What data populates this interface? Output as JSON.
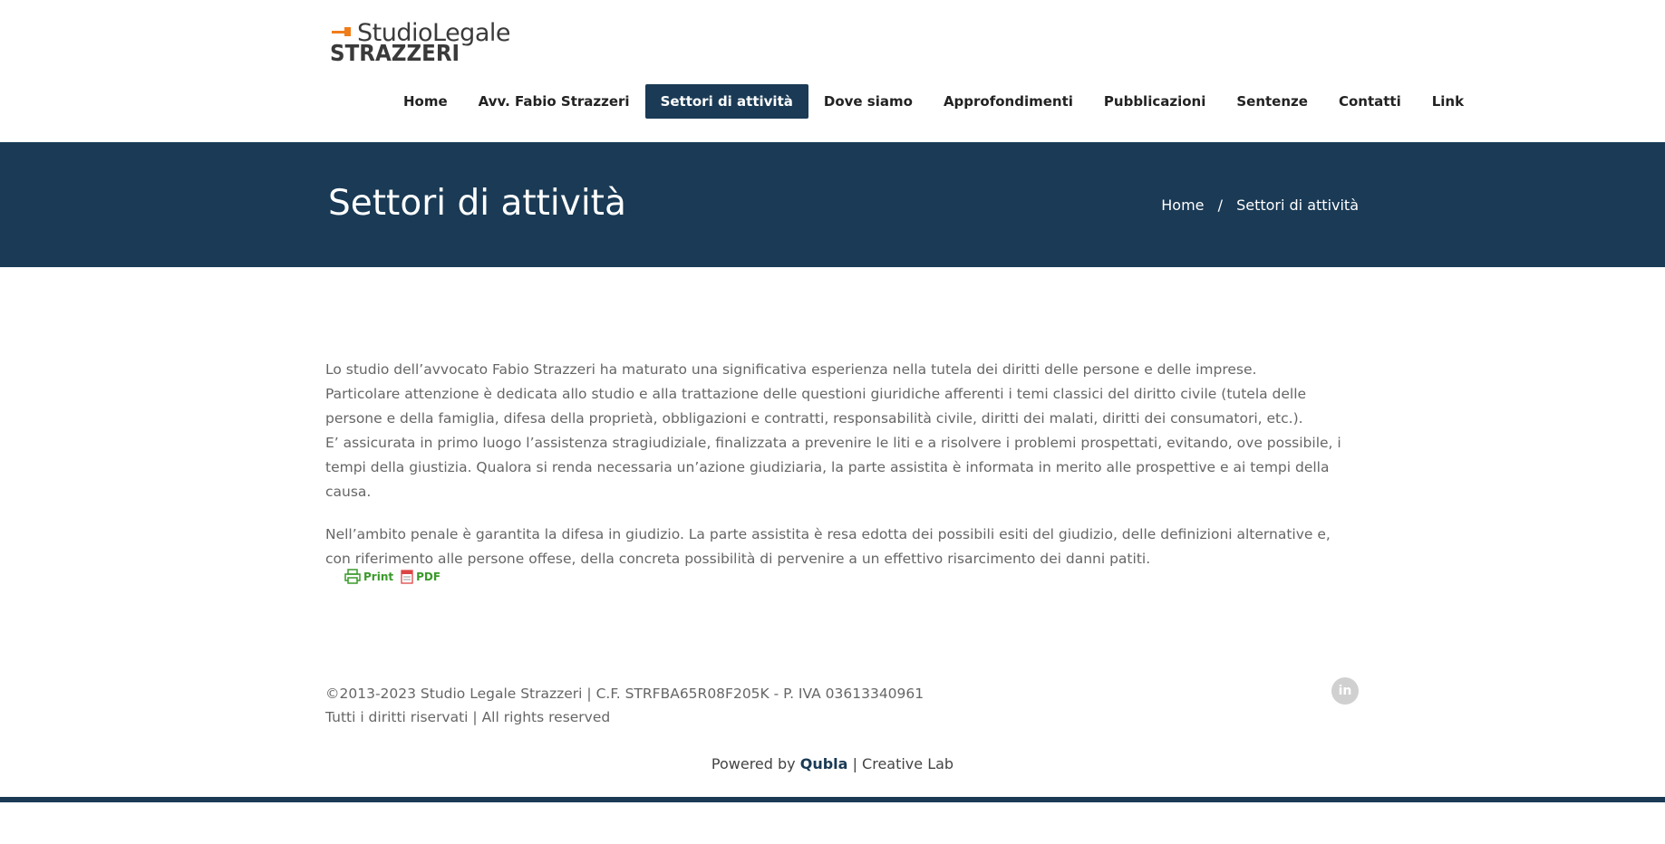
{
  "logo": {
    "line1": "StudioLegale",
    "line2": "STRAZZERI",
    "accent_color": "#f07d1a"
  },
  "nav": {
    "items": [
      "Home",
      "Avv. Fabio Strazzeri",
      "Settori di attività",
      "Dove siamo",
      "Approfondimenti",
      "Pubblicazioni",
      "Sentenze",
      "Contatti",
      "Link"
    ],
    "active": "Settori di attività"
  },
  "title_bar": {
    "title": "Settori di attività",
    "breadcrumb": {
      "home": "Home",
      "separator": "/",
      "current": "Settori di attività"
    }
  },
  "content": {
    "paragraphs": [
      "Lo studio dell’avvocato Fabio Strazzeri ha maturato una significativa esperienza nella tutela dei diritti delle persone e delle imprese.",
      "Particolare attenzione è dedicata allo studio e alla trattazione delle questioni giuridiche afferenti i temi classici del diritto civile (tutela delle persone e della famiglia, difesa della proprietà, obbligazioni e contratti, responsabilità civile, diritti dei malati, diritti dei consumatori, etc.).",
      "E’ assicurata in primo luogo l’assistenza stragiudiziale, finalizzata a prevenire le liti e a risolvere i problemi prospettati, evitando, ove possibile, i tempi della giustizia. Qualora si renda necessaria un’azione giudiziaria, la parte assistita è informata in merito alle prospettive e ai tempi della causa.",
      "Nell’ambito penale è garantita la difesa in giudizio. La parte assistita è resa edotta dei possibili esiti del giudizio, delle definizioni alternative e, con riferimento alle persone offese, della concreta possibilità di pervenire a un effettivo risarcimento dei danni patiti."
    ]
  },
  "print_pdf": {
    "print_label": "Print",
    "pdf_label": "PDF",
    "color": "#3a9a2a"
  },
  "footer": {
    "line1": "©2013-2023 Studio Legale Strazzeri | C.F. STRFBA65R08F205K - P. IVA 03613340961",
    "line2": "Tutti i diritti riservati | All rights reserved",
    "social_icon": "linkedin-icon",
    "social_label": "in",
    "powered_prefix": "Powered by",
    "powered_brand": "Qubla",
    "powered_suffix": "| Creative Lab"
  },
  "colors": {
    "primary": "#1a3a55",
    "text": "#666666"
  }
}
